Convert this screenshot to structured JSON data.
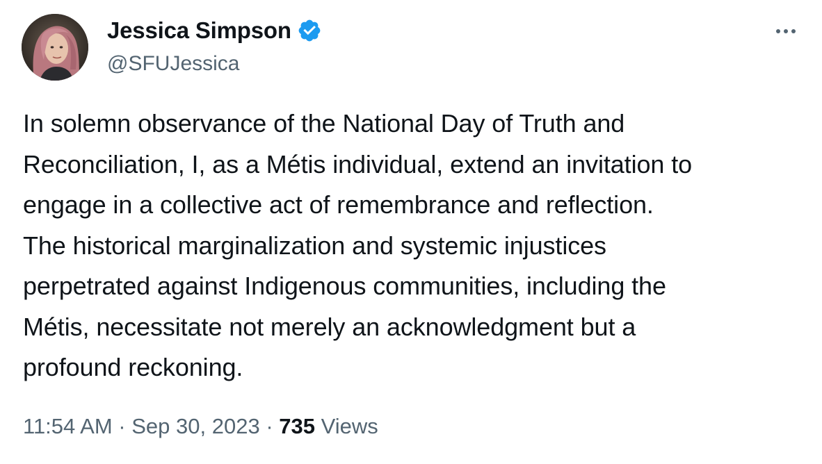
{
  "author": {
    "display_name": "Jessica Simpson",
    "handle": "@SFUJessica",
    "verified_color": "#1d9bf0"
  },
  "tweet": {
    "lines": [
      "In solemn observance of the National Day of Truth and",
      "Reconciliation, I, as a Métis individual, extend an invitation to",
      "engage in a collective act of remembrance and reflection.",
      "The historical marginalization and systemic injustices",
      "perpetrated against Indigenous communities, including the",
      "Métis, necessitate not merely an acknowledgment but a",
      "profound reckoning."
    ]
  },
  "meta": {
    "time": "11:54 AM",
    "separator": " · ",
    "date": "Sep 30, 2023",
    "views_count": "735",
    "views_label": " Views"
  },
  "icons": {
    "verified": "verified-badge-icon",
    "more": "more-options-icon"
  }
}
